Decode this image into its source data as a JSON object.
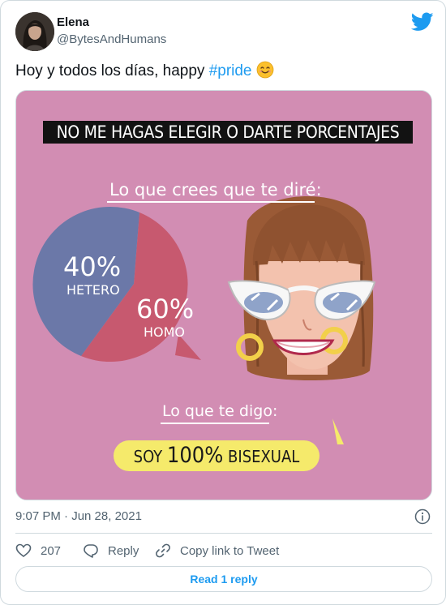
{
  "author": {
    "name": "Elena",
    "handle": "@BytesAndHumans"
  },
  "tweet": {
    "text_prefix": "Hoy y todos los días, happy ",
    "hashtag": "#pride",
    "emoji": "smiling-face-icon"
  },
  "media": {
    "banner": "NO ME HAGAS ELEGIR O DARTE PORCENTAJES",
    "caption_top": "Lo que crees que te diré:",
    "pie": [
      {
        "percent": "40%",
        "label": "HETERO",
        "value": 40,
        "color": "#6b78a8"
      },
      {
        "percent": "60%",
        "label": "HOMO",
        "value": 60,
        "color": "#c7596f"
      }
    ],
    "caption_bottom": "Lo que te digo:",
    "bubble": {
      "prefix": "SOY ",
      "number": "100%",
      "suffix": " BISEXUAL"
    },
    "colors": {
      "background": "#d28db3",
      "bubble": "#f5ea6b"
    }
  },
  "timestamp": "9:07 PM · Jun 28, 2021",
  "actions": {
    "likes": "207",
    "reply_label": "Reply",
    "copy_label": "Copy link to Tweet"
  },
  "read_replies_label": "Read 1 reply"
}
